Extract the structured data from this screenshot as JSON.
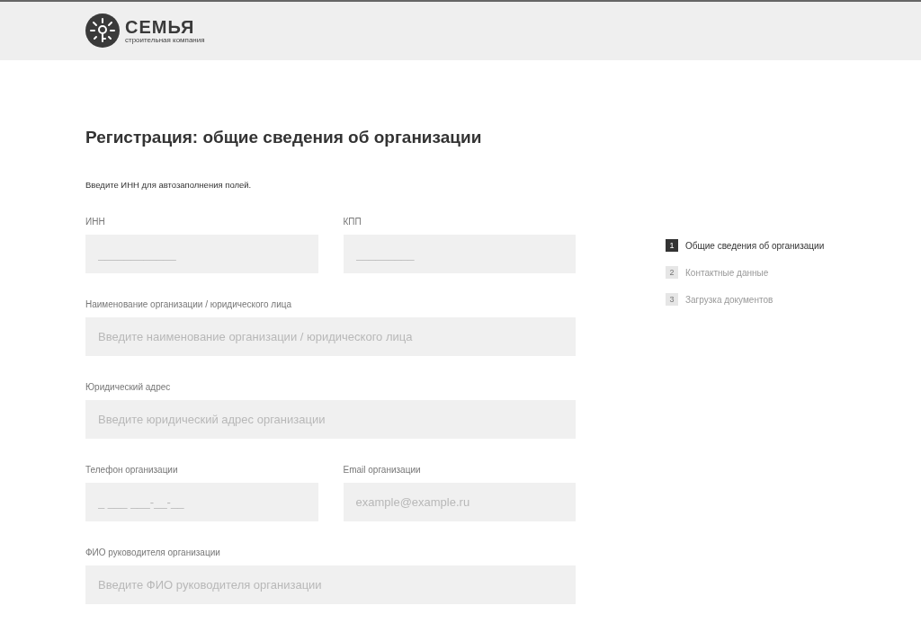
{
  "header": {
    "logo": {
      "name": "СЕМЬЯ",
      "tagline": "строительная компания"
    }
  },
  "title": "Регистрация: общие сведения об организации",
  "hint": "Введите ИНН для автозаполнения полей.",
  "rows": [
    {
      "fields": [
        {
          "label": "ИНН",
          "placeholder": "____________"
        },
        {
          "label": "КПП",
          "placeholder": "_________"
        }
      ]
    },
    {
      "fields": [
        {
          "label": "Наименование организации / юридического лица",
          "placeholder": "Введите наименование организации / юридического лица"
        }
      ]
    },
    {
      "fields": [
        {
          "label": "Юридический адрес",
          "placeholder": "Введите юридический адрес организации"
        }
      ]
    },
    {
      "fields": [
        {
          "label": "Телефон организации",
          "placeholder": "_ ___ ___-__-__"
        },
        {
          "label": "Email организации",
          "placeholder": "example@example.ru"
        }
      ]
    },
    {
      "fields": [
        {
          "label": "ФИО руководителя организации",
          "placeholder": "Введите ФИО руководителя организации"
        }
      ]
    }
  ],
  "steps": [
    {
      "number": "1",
      "label": "Общие сведения об организации",
      "selected": true
    },
    {
      "number": "2",
      "label": "Контактные данные",
      "selected": false
    },
    {
      "number": "3",
      "label": "Загрузка документов",
      "selected": false
    }
  ]
}
